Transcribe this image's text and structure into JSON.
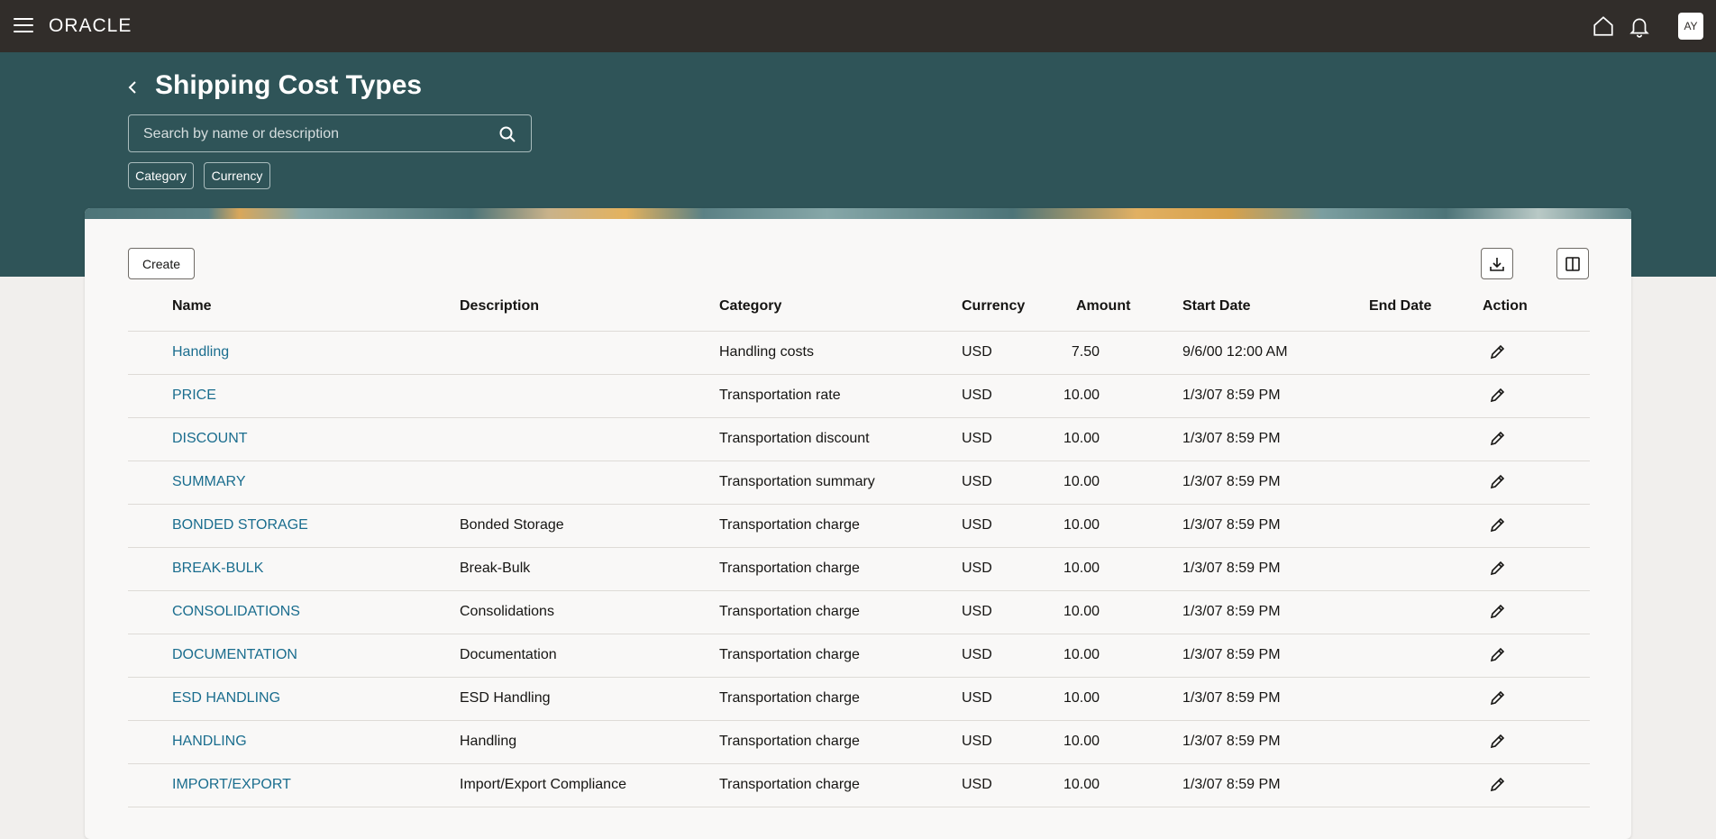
{
  "header": {
    "logo_text": "ORACLE",
    "avatar_initials": "AY"
  },
  "page": {
    "title": "Shipping Cost Types",
    "search_placeholder": "Search by name or description",
    "filters": [
      "Category",
      "Currency"
    ],
    "create_label": "Create"
  },
  "table": {
    "columns": [
      "Name",
      "Description",
      "Category",
      "Currency",
      "Amount",
      "Start Date",
      "End Date",
      "Action"
    ],
    "rows": [
      {
        "name": "Handling",
        "description": "",
        "category": "Handling costs",
        "currency": "USD",
        "amount": "7.50",
        "start_date": "9/6/00 12:00 AM",
        "end_date": ""
      },
      {
        "name": "PRICE",
        "description": "",
        "category": "Transportation rate",
        "currency": "USD",
        "amount": "10.00",
        "start_date": "1/3/07 8:59 PM",
        "end_date": ""
      },
      {
        "name": "DISCOUNT",
        "description": "",
        "category": "Transportation discount",
        "currency": "USD",
        "amount": "10.00",
        "start_date": "1/3/07 8:59 PM",
        "end_date": ""
      },
      {
        "name": "SUMMARY",
        "description": "",
        "category": "Transportation summary",
        "currency": "USD",
        "amount": "10.00",
        "start_date": "1/3/07 8:59 PM",
        "end_date": ""
      },
      {
        "name": "BONDED STORAGE",
        "description": "Bonded Storage",
        "category": "Transportation charge",
        "currency": "USD",
        "amount": "10.00",
        "start_date": "1/3/07 8:59 PM",
        "end_date": ""
      },
      {
        "name": "BREAK-BULK",
        "description": "Break-Bulk",
        "category": "Transportation charge",
        "currency": "USD",
        "amount": "10.00",
        "start_date": "1/3/07 8:59 PM",
        "end_date": ""
      },
      {
        "name": "CONSOLIDATIONS",
        "description": "Consolidations",
        "category": "Transportation charge",
        "currency": "USD",
        "amount": "10.00",
        "start_date": "1/3/07 8:59 PM",
        "end_date": ""
      },
      {
        "name": "DOCUMENTATION",
        "description": "Documentation",
        "category": "Transportation charge",
        "currency": "USD",
        "amount": "10.00",
        "start_date": "1/3/07 8:59 PM",
        "end_date": ""
      },
      {
        "name": "ESD HANDLING",
        "description": "ESD Handling",
        "category": "Transportation charge",
        "currency": "USD",
        "amount": "10.00",
        "start_date": "1/3/07 8:59 PM",
        "end_date": ""
      },
      {
        "name": "HANDLING",
        "description": "Handling",
        "category": "Transportation charge",
        "currency": "USD",
        "amount": "10.00",
        "start_date": "1/3/07 8:59 PM",
        "end_date": ""
      },
      {
        "name": "IMPORT/EXPORT",
        "description": "Import/Export Compliance",
        "category": "Transportation charge",
        "currency": "USD",
        "amount": "10.00",
        "start_date": "1/3/07 8:59 PM",
        "end_date": ""
      }
    ]
  },
  "icons": {
    "menu": "hamburger-menu-icon",
    "home": "home-icon",
    "notifications": "bell-icon",
    "back": "chevron-left-icon",
    "search": "search-icon",
    "download": "download-icon",
    "columns": "columns-icon",
    "edit": "pencil-icon"
  },
  "colors": {
    "topbar": "#312d2a",
    "band": "#2f5458",
    "link": "#1a6d8e"
  }
}
